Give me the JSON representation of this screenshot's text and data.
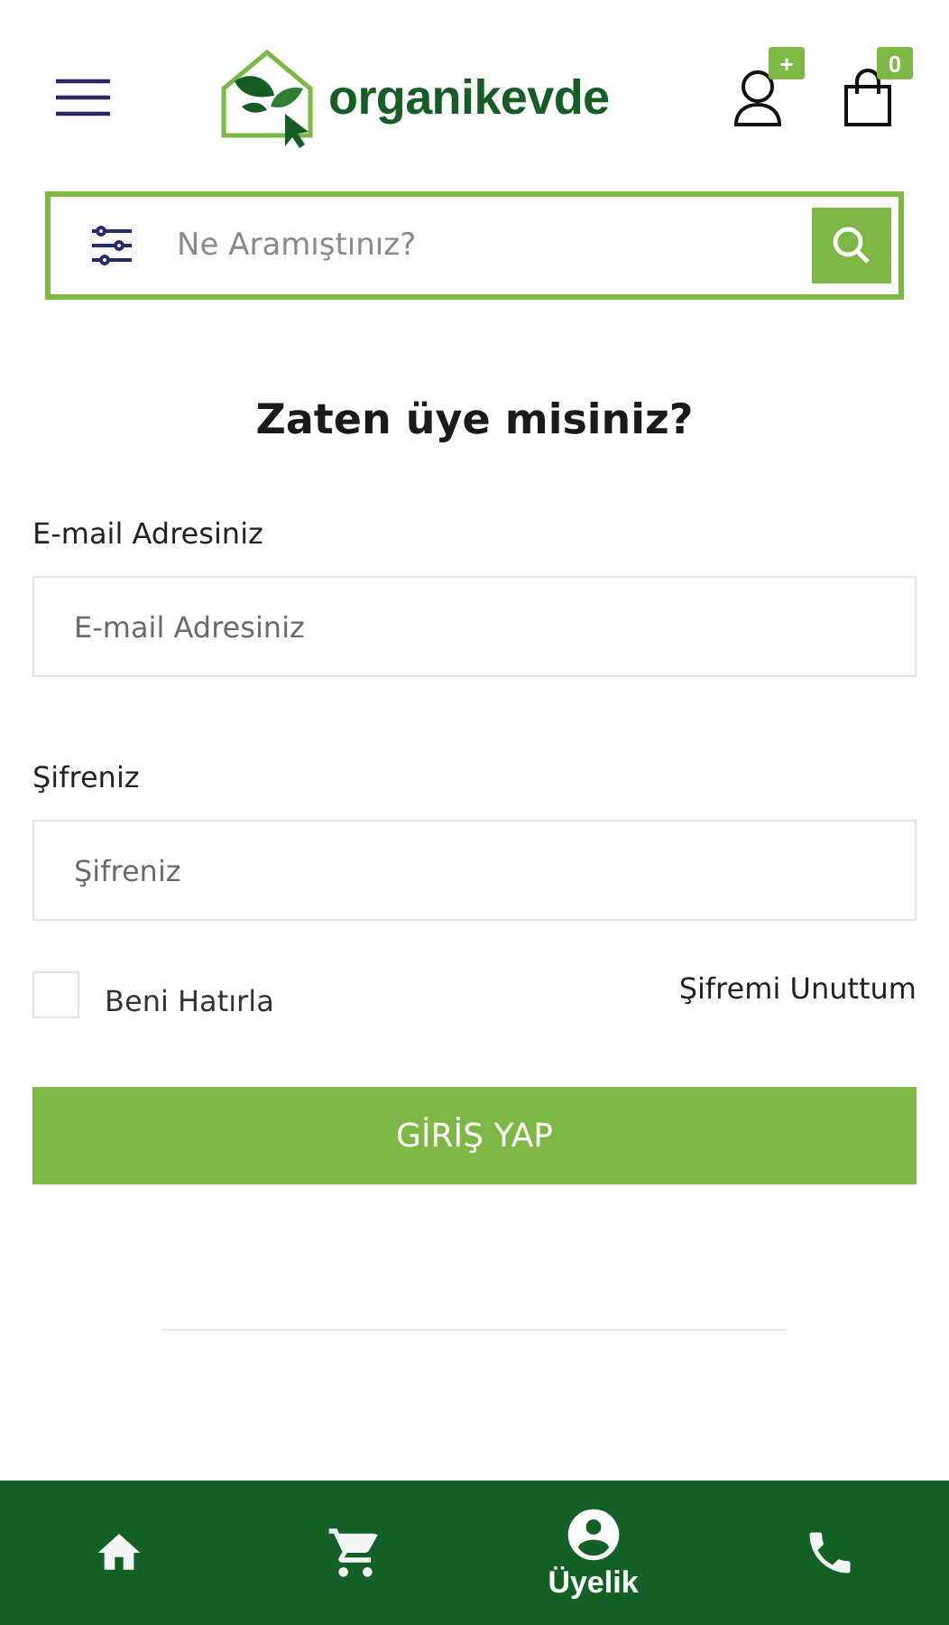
{
  "header": {
    "logo": "organikevde",
    "account_badge": "+",
    "cart_badge": "0"
  },
  "search": {
    "placeholder": "Ne Aramıştınız?"
  },
  "login": {
    "title": "Zaten üye misiniz?",
    "fields": [
      {
        "label": "E-mail Adresiniz",
        "placeholder": "E-mail Adresiniz"
      },
      {
        "label": "Şifreniz",
        "placeholder": "Şifreniz"
      }
    ],
    "remember": {
      "label": "Beni Hatırla",
      "checked": false
    },
    "forgot": "Şifremi Unuttum",
    "submit": "GİRİŞ YAP"
  },
  "bottom_nav": [
    {
      "kind": "home",
      "selected": false
    },
    {
      "kind": "cart",
      "selected": false
    },
    {
      "kind": "account",
      "label": "Üyelik",
      "selected": true
    },
    {
      "kind": "phone",
      "selected": false
    }
  ]
}
